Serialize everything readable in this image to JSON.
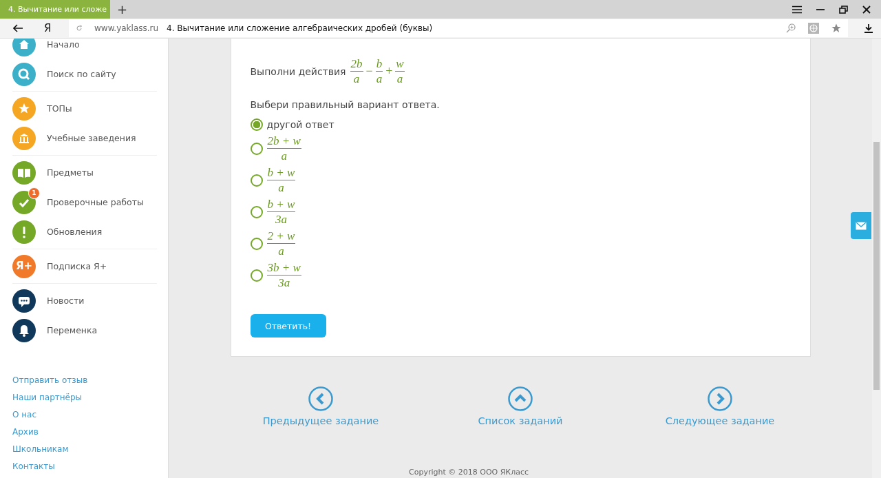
{
  "browser": {
    "tab": {
      "title": "4. Вычитание или сложе",
      "selected": true
    },
    "new_tab": "+",
    "url_host": "www.yaklass.ru",
    "url_title": "4. Вычитание или сложение алгебраических дробей (буквы)",
    "logo": "Я"
  },
  "sidebar": {
    "groups": [
      {
        "items": [
          {
            "label": "Начало",
            "color": "#3cb0c9"
          },
          {
            "label": "Поиск по сайту",
            "color": "#3cb0c9"
          }
        ]
      },
      {
        "items": [
          {
            "label": "ТОПы",
            "color": "#f5a623"
          },
          {
            "label": "Учебные заведения",
            "color": "#f5a623"
          }
        ]
      },
      {
        "items": [
          {
            "label": "Предметы",
            "color": "#76a828"
          },
          {
            "label": "Проверочные работы",
            "color": "#76a828",
            "badge": "1"
          },
          {
            "label": "Обновления",
            "color": "#76a828"
          }
        ]
      },
      {
        "items": [
          {
            "label": "Подписка Я+",
            "color": "#f07a2a",
            "icon_text": "Я+"
          }
        ]
      },
      {
        "items": [
          {
            "label": "Новости",
            "color": "#10385a"
          },
          {
            "label": "Переменка",
            "color": "#10385a"
          }
        ]
      }
    ],
    "links": [
      "Отправить отзыв",
      "Наши партнёры",
      "О нас",
      "Архив",
      "Школьникам",
      "Контакты"
    ]
  },
  "task": {
    "prompt": "Выполни действия",
    "expression": [
      {
        "kind": "fraction",
        "num": "2b",
        "den": "a"
      },
      {
        "kind": "operator",
        "text": "−"
      },
      {
        "kind": "fraction",
        "num": "b",
        "den": "a"
      },
      {
        "kind": "operator",
        "text": "+"
      },
      {
        "kind": "fraction",
        "num": "w",
        "den": "a"
      }
    ],
    "instruction": "Выбери правильный вариант ответа.",
    "options": [
      {
        "kind": "text",
        "label": "другой ответ",
        "selected": true
      },
      {
        "kind": "fraction",
        "num": "2b + w",
        "den": "a",
        "selected": false
      },
      {
        "kind": "fraction",
        "num": "b + w",
        "den": "a",
        "selected": false
      },
      {
        "kind": "fraction",
        "num": "b + w",
        "den": "3a",
        "selected": false
      },
      {
        "kind": "fraction",
        "num": "2 + w",
        "den": "a",
        "selected": false
      },
      {
        "kind": "fraction",
        "num": "3b + w",
        "den": "3a",
        "selected": false
      }
    ],
    "submit": "Ответить!"
  },
  "navigation": [
    {
      "kind": "prev",
      "label": "Предыдущее задание"
    },
    {
      "kind": "list",
      "label": "Список заданий"
    },
    {
      "kind": "next",
      "label": "Следующее задание"
    }
  ],
  "footer": {
    "copyright": "Copyright © 2018 ООО ЯКласс"
  }
}
